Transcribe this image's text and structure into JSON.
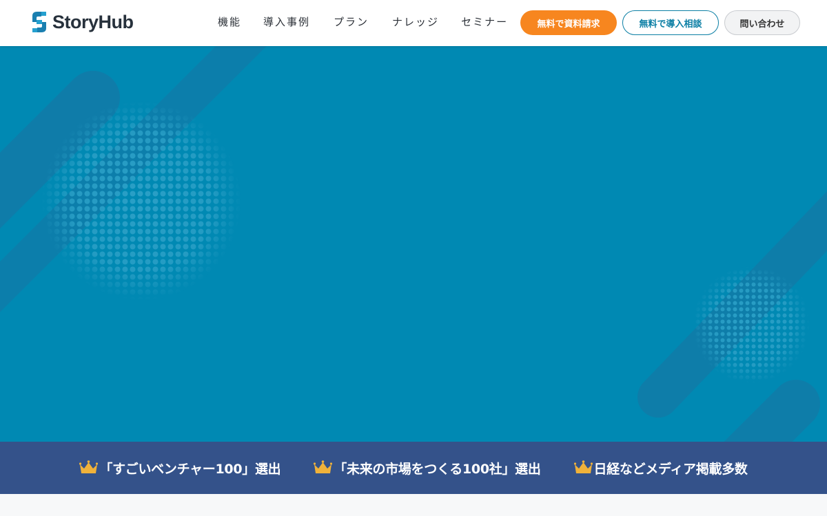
{
  "brand": {
    "name": "StoryHub"
  },
  "nav": [
    {
      "label": "機能"
    },
    {
      "label": "導入事例"
    },
    {
      "label": "プラン"
    },
    {
      "label": "ナレッジ"
    },
    {
      "label": "セミナー"
    }
  ],
  "cta": {
    "docs_label": "無料で資料請求",
    "consult_label": "無料で導入相談",
    "contact_label": "問い合わせ"
  },
  "awards": [
    {
      "text": "「すごいベンチャー100」選出",
      "icon": "crown-icon"
    },
    {
      "text": "「未来の市場をつくる100社」選出",
      "icon": "crown-icon"
    },
    {
      "text": "日経などメディア掲載多数",
      "icon": "crown-icon"
    }
  ],
  "colors": {
    "hero": "#0089b3",
    "awards_band": "#34528a",
    "cta_orange": "#f7861f",
    "accent": "#0a7ea4",
    "crown": "#f0b23a"
  }
}
